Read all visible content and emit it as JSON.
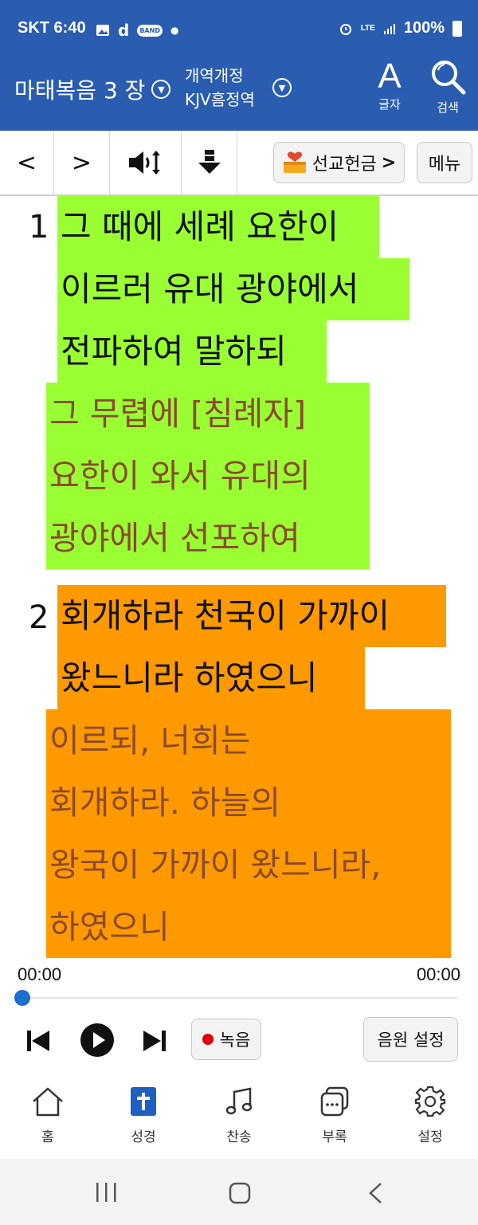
{
  "status_bar": {
    "carrier_time": "SKT 6:40",
    "band": "BAND",
    "d": "d",
    "lte": "LTE",
    "battery": "100%"
  },
  "header": {
    "book_chapter": "마태복음 3 장",
    "version_line1": "개역개정",
    "version_line2": "KJV흠정역",
    "font_button_big": "A",
    "font_button_label": "글자",
    "search_label": "검색"
  },
  "toolbar": {
    "prev": "<",
    "next": ">",
    "mission_label": "선교헌금",
    "mission_chevron": ">",
    "menu_label": "메뉴"
  },
  "verses": [
    {
      "number": "1",
      "highlight": "#99ff33",
      "korean_lines": [
        "그 때에 세례 요한이",
        "이르러 유대 광야에서",
        "전파하여 말하되"
      ],
      "kjv_lines": [
        "그 무렵에 [침례자]",
        "요한이 와서 유대의",
        "광야에서 선포하여"
      ]
    },
    {
      "number": "2",
      "highlight": "#ff9900",
      "korean_lines": [
        "회개하라 천국이 가까이",
        "왔느니라 하였으니"
      ],
      "kjv_lines": [
        "이르되, 너희는",
        "회개하라. 하늘의",
        "왕국이 가까이 왔느니라,",
        "하였으니"
      ]
    }
  ],
  "player": {
    "time_current": "00:00",
    "time_total": "00:00",
    "progress": 0,
    "record_label": "녹음",
    "source_settings_label": "음원 설정"
  },
  "bottom_nav": [
    {
      "label": "홈",
      "icon": "home-icon"
    },
    {
      "label": "성경",
      "icon": "bible-icon"
    },
    {
      "label": "찬송",
      "icon": "music-note-icon"
    },
    {
      "label": "부록",
      "icon": "appendix-icon"
    },
    {
      "label": "설정",
      "icon": "gear-icon"
    }
  ],
  "colors": {
    "header_bg": "#2a5db0",
    "accent": "#1a6fd0",
    "kjv_text": "#8a4a2e"
  }
}
